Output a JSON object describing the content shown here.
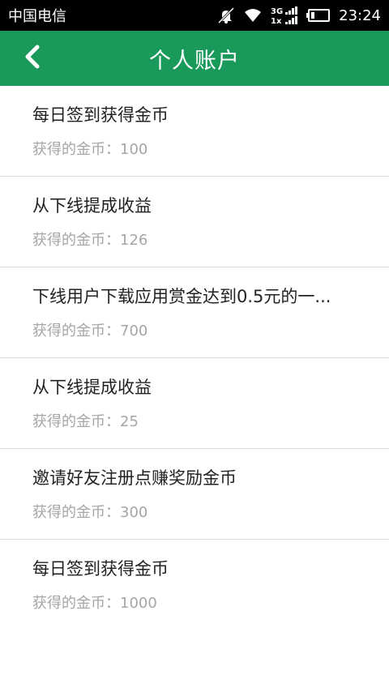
{
  "status_bar": {
    "carrier": "中国电信",
    "network": "3G",
    "network_sub": "1x",
    "time": "23:24",
    "icons": [
      "mute-icon",
      "wifi-icon",
      "signal-icon",
      "battery-icon"
    ]
  },
  "header": {
    "back_icon": "chevron-left-icon",
    "title": "个人账户",
    "background": "#1a9a5a"
  },
  "records": [
    {
      "title": "每日签到获得金币",
      "coins_label": "获得的金币：",
      "coins": "100"
    },
    {
      "title": "从下线提成收益",
      "coins_label": "获得的金币：",
      "coins": "126"
    },
    {
      "title": "下线用户下载应用赏金达到0.5元的一...",
      "coins_label": "获得的金币：",
      "coins": "700"
    },
    {
      "title": "从下线提成收益",
      "coins_label": "获得的金币：",
      "coins": "25"
    },
    {
      "title": "邀请好友注册点赚奖励金币",
      "coins_label": "获得的金币：",
      "coins": "300"
    },
    {
      "title": "每日签到获得金币",
      "coins_label": "获得的金币：",
      "coins": "1000"
    }
  ]
}
